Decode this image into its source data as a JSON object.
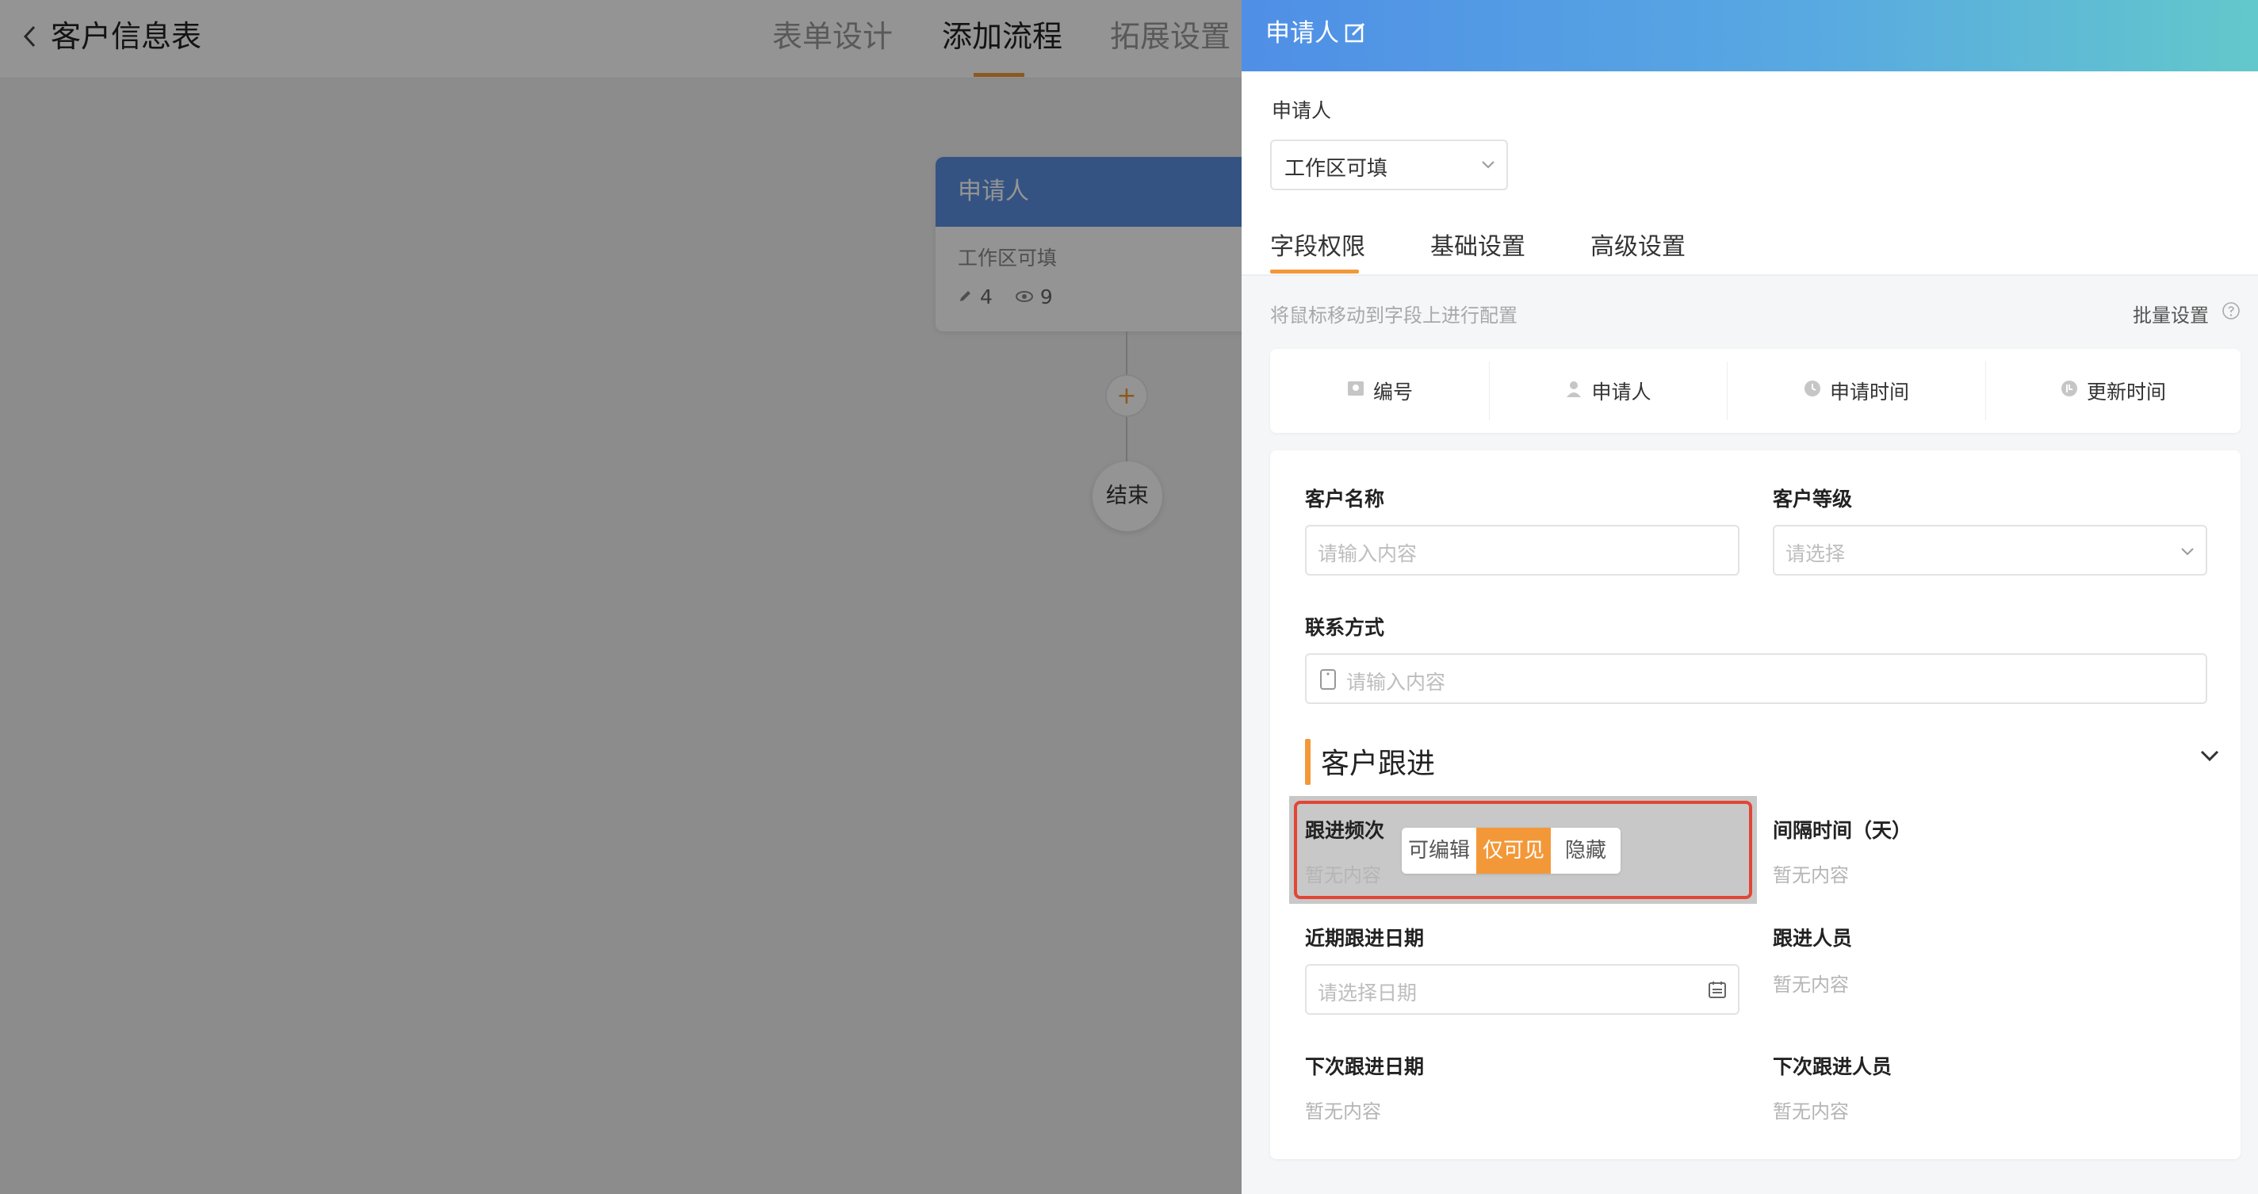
{
  "header": {
    "form_title": "客户信息表",
    "tabs": [
      {
        "label": "表单设计",
        "active": false
      },
      {
        "label": "添加流程",
        "active": true
      },
      {
        "label": "拓展设置",
        "active": false
      }
    ]
  },
  "flow": {
    "node": {
      "title": "申请人",
      "subtitle": "工作区可填",
      "edit_count": "4",
      "view_count": "9"
    },
    "add_symbol": "+",
    "end_label": "结束"
  },
  "drawer": {
    "title": "申请人",
    "applicant_label": "申请人",
    "applicant_select": "工作区可填",
    "tabs": [
      {
        "label": "字段权限",
        "active": true
      },
      {
        "label": "基础设置",
        "active": false
      },
      {
        "label": "高级设置",
        "active": false
      }
    ],
    "hint": "将鼠标移动到字段上进行配置",
    "batch_label": "批量设置",
    "system_fields": [
      {
        "label": "编号",
        "icon": "id-card-icon"
      },
      {
        "label": "申请人",
        "icon": "person-icon"
      },
      {
        "label": "申请时间",
        "icon": "clock-icon"
      },
      {
        "label": "更新时间",
        "icon": "update-clock-icon"
      }
    ],
    "fields": {
      "customer_name": {
        "label": "客户名称",
        "placeholder": "请输入内容"
      },
      "customer_level": {
        "label": "客户等级",
        "placeholder": "请选择"
      },
      "contact": {
        "label": "联系方式",
        "placeholder": "请输入内容"
      },
      "section_title": "客户跟进",
      "follow_freq": {
        "label": "跟进频次",
        "value": "暂无内容"
      },
      "interval": {
        "label": "间隔时间（天）",
        "value": "暂无内容"
      },
      "recent_date": {
        "label": "近期跟进日期",
        "placeholder": "请选择日期"
      },
      "follower": {
        "label": "跟进人员",
        "value": "暂无内容"
      },
      "next_date": {
        "label": "下次跟进日期",
        "value": "暂无内容"
      },
      "next_follower": {
        "label": "下次跟进人员",
        "value": "暂无内容"
      }
    },
    "permission_options": [
      {
        "label": "可编辑",
        "active": false
      },
      {
        "label": "仅可见",
        "active": true
      },
      {
        "label": "隐藏",
        "active": false
      }
    ]
  },
  "colors": {
    "accent": "#f39839",
    "header_gradient_start": "#4f8fe6",
    "header_gradient_end": "#63c8cb",
    "highlight_border": "#e24536"
  }
}
